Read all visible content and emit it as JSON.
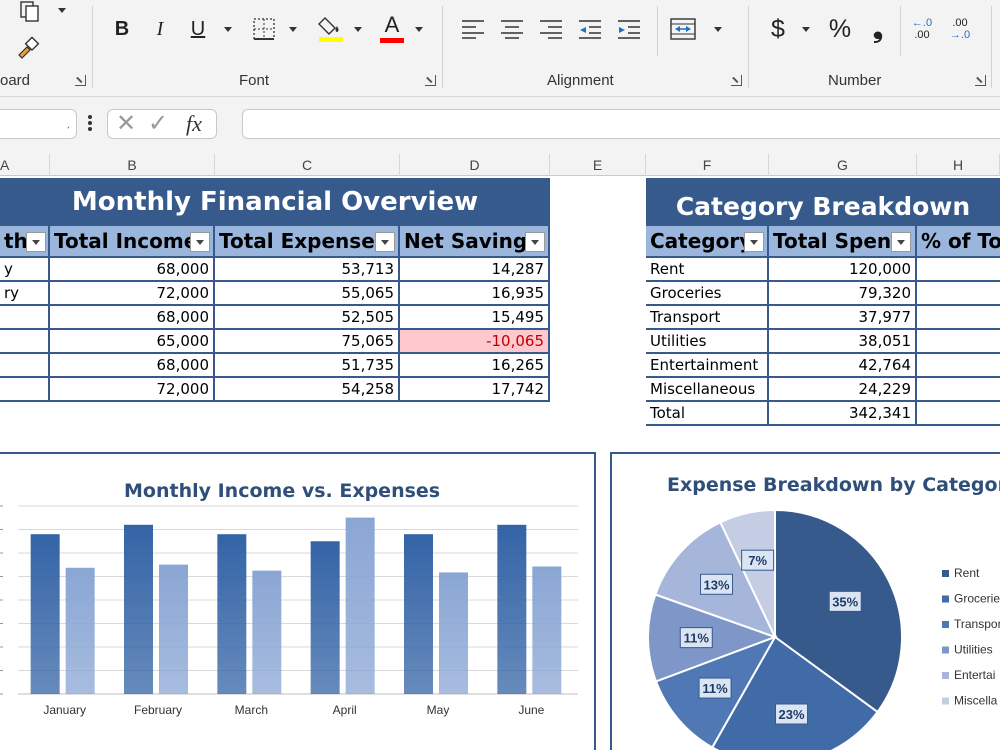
{
  "ribbon": {
    "groups": [
      {
        "name": "clipboard",
        "label": "oard"
      },
      {
        "name": "font",
        "label": "Font"
      },
      {
        "name": "alignment",
        "label": "Alignment"
      },
      {
        "name": "number",
        "label": "Number"
      }
    ],
    "font_buttons": {
      "bold": "B",
      "italic": "I",
      "underline": "U",
      "font_color_glyph": "A"
    },
    "number_buttons": {
      "currency": "$",
      "percent": "%",
      "comma": "❟",
      "decrease_decimal": ".00",
      "increase_decimal": ".0"
    },
    "colors": {
      "highlight": "#ffff00",
      "font_color": "#ff0000"
    }
  },
  "formula_bar": {
    "fx": "fx",
    "name_box_value": "",
    "formula_value": ""
  },
  "columns": [
    "A",
    "B",
    "C",
    "D",
    "E",
    "F",
    "G",
    "H"
  ],
  "financial": {
    "title": "Monthly Financial Overview",
    "headers": [
      "th",
      "Total Income",
      "Total Expenses",
      "Net Savings"
    ],
    "rows": [
      {
        "month": "y",
        "income": "68,000",
        "expenses": "53,713",
        "savings": "14,287"
      },
      {
        "month": "ry",
        "income": "72,000",
        "expenses": "55,065",
        "savings": "16,935"
      },
      {
        "month": "",
        "income": "68,000",
        "expenses": "52,505",
        "savings": "15,495"
      },
      {
        "month": "",
        "income": "65,000",
        "expenses": "75,065",
        "savings": "-10,065"
      },
      {
        "month": "",
        "income": "68,000",
        "expenses": "51,735",
        "savings": "16,265"
      },
      {
        "month": "",
        "income": "72,000",
        "expenses": "54,258",
        "savings": "17,742"
      }
    ]
  },
  "category": {
    "title": "Category Breakdown",
    "headers": [
      "Category",
      "Total Spent",
      "% of Tot"
    ],
    "rows": [
      {
        "name": "Rent",
        "spent": "120,000"
      },
      {
        "name": "Groceries",
        "spent": "79,320"
      },
      {
        "name": "Transport",
        "spent": "37,977"
      },
      {
        "name": "Utilities",
        "spent": "38,051"
      },
      {
        "name": "Entertainment",
        "spent": "42,764"
      },
      {
        "name": "Miscellaneous",
        "spent": "24,229"
      },
      {
        "name": "Total",
        "spent": "342,341"
      }
    ]
  },
  "chart_data": [
    {
      "type": "bar",
      "title": "Monthly Income vs. Expenses",
      "categories": [
        "January",
        "February",
        "March",
        "April",
        "May",
        "June"
      ],
      "series": [
        {
          "values": [
            68000,
            72000,
            68000,
            65000,
            68000,
            72000
          ],
          "color": "#3464a6"
        },
        {
          "values": [
            53713,
            55065,
            52505,
            75065,
            51735,
            54258
          ],
          "color": "#8aa6d4"
        }
      ],
      "ylim": [
        0,
        80000
      ],
      "grid": true,
      "legend": "none"
    },
    {
      "type": "pie",
      "title": "Expense Breakdown by Category",
      "labels": [
        "Rent",
        "Groceries",
        "Transport",
        "Utilities",
        "Entertainment",
        "Miscellaneous"
      ],
      "legend_labels": [
        "Rent",
        "Grocerie",
        "Transpor",
        "Utilities",
        "Entertai",
        "Miscella"
      ],
      "values": [
        120000,
        79320,
        37977,
        38051,
        42764,
        24229
      ],
      "data_labels": [
        "35%",
        "23%",
        "11%",
        "11%",
        "13%",
        "7%"
      ],
      "colors": [
        "#375a8c",
        "#416ba6",
        "#5078b5",
        "#7f97c8",
        "#a5b6da",
        "#c4cde3"
      ],
      "legend": "right"
    }
  ]
}
